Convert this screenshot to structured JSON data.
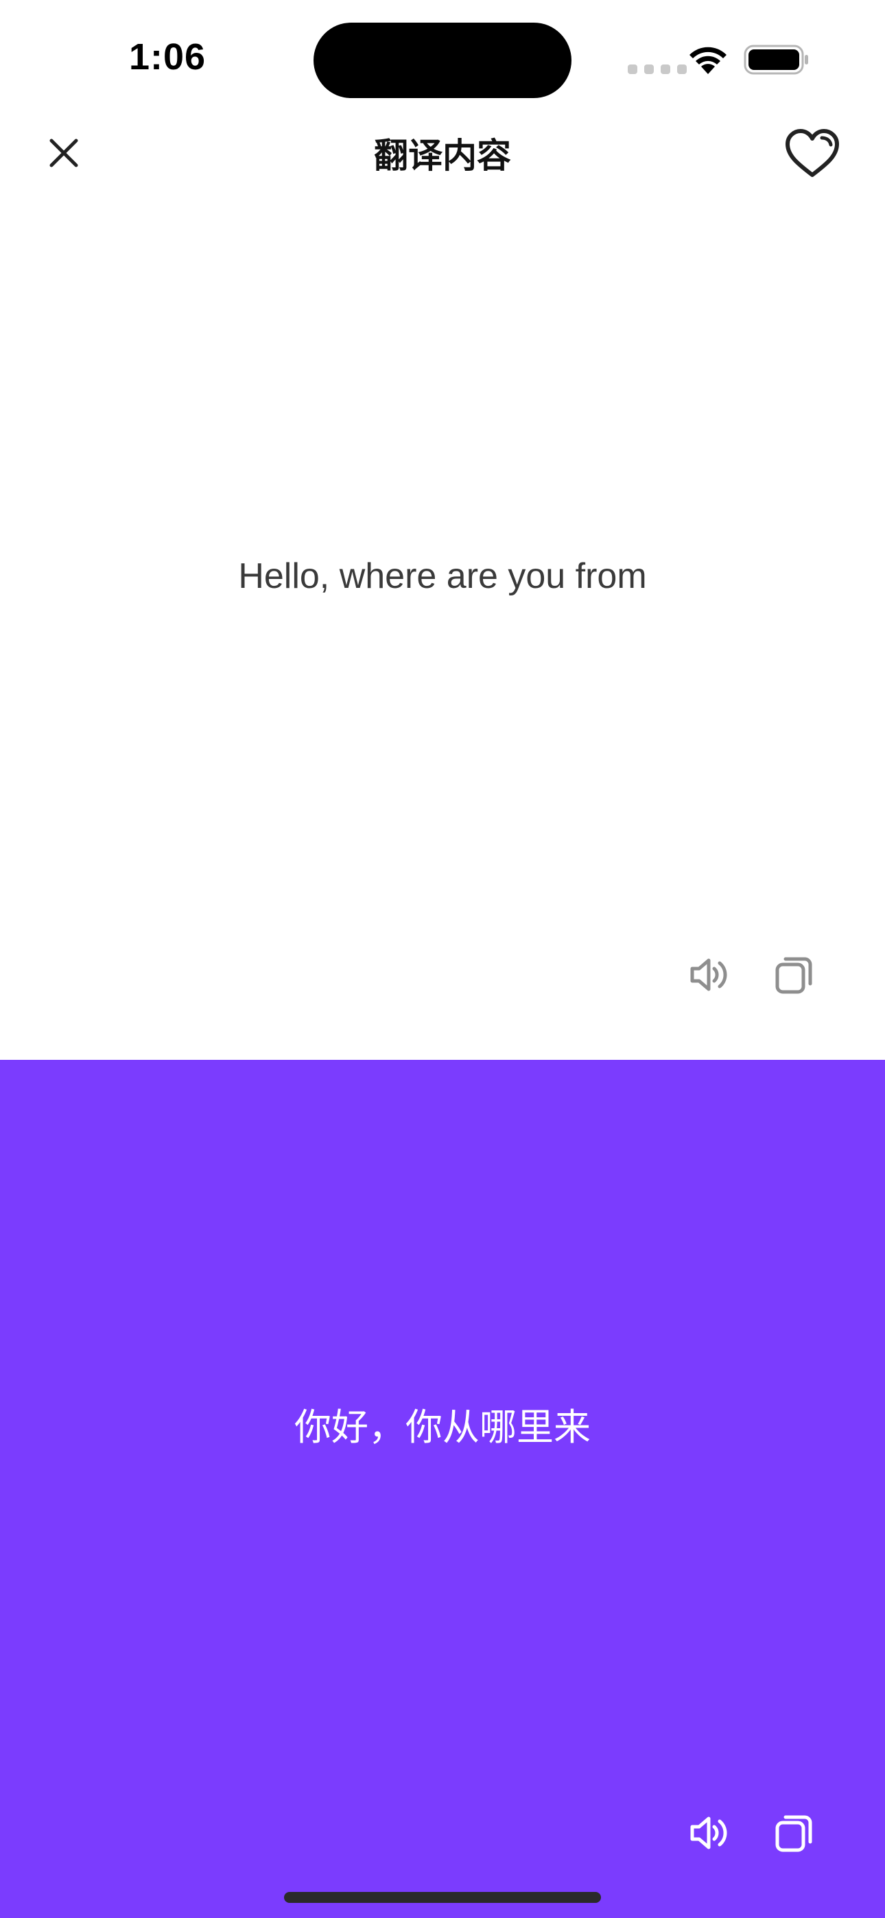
{
  "status_bar": {
    "time": "1:06"
  },
  "nav": {
    "title": "翻译内容",
    "close_icon": "close-icon",
    "favorite_icon": "heart-icon"
  },
  "source": {
    "text": "Hello, where are you from"
  },
  "target": {
    "text": "你好，你从哪里来"
  },
  "colors": {
    "accent": "#7b3cfe",
    "source_text": "#3a3a3a",
    "icon_gray": "#8e8e8e",
    "white": "#ffffff"
  },
  "icons": {
    "speaker": "speaker-icon",
    "copy": "copy-icon"
  }
}
